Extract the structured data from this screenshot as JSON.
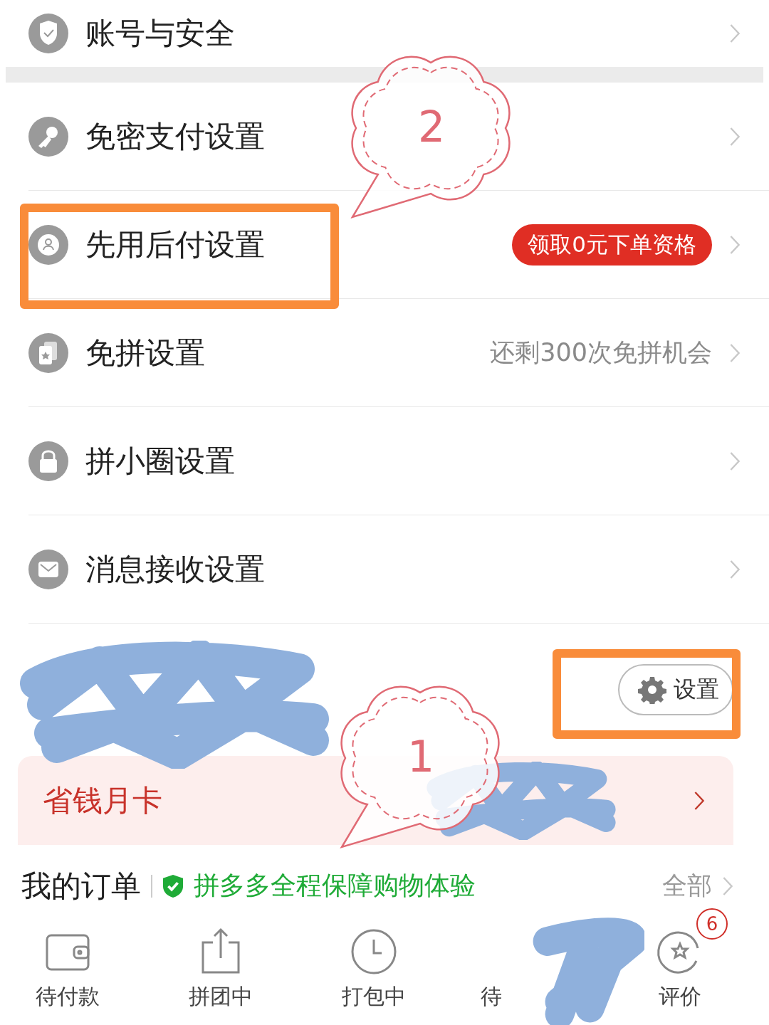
{
  "settings_list": [
    {
      "title": "账号与安全"
    },
    {
      "title": "免密支付设置"
    },
    {
      "title": "先用后付设置",
      "badge": "领取0元下单资格"
    },
    {
      "title": "免拼设置",
      "hint": "还剩300次免拼机会"
    },
    {
      "title": "拼小圈设置"
    },
    {
      "title": "消息接收设置"
    }
  ],
  "profile": {
    "settings_button": "设置"
  },
  "card": {
    "title": "省钱月卡"
  },
  "orders": {
    "title": "我的订单",
    "guarantee": "拼多多全程保障购物体验",
    "all_link": "全部",
    "items": [
      {
        "label": "待付款"
      },
      {
        "label": "拼团中"
      },
      {
        "label": "打包中"
      },
      {
        "label": "待"
      },
      {
        "label": "评价",
        "badge": "6"
      }
    ]
  },
  "annotations": {
    "callouts": [
      {
        "number": "2"
      },
      {
        "number": "1"
      }
    ]
  }
}
